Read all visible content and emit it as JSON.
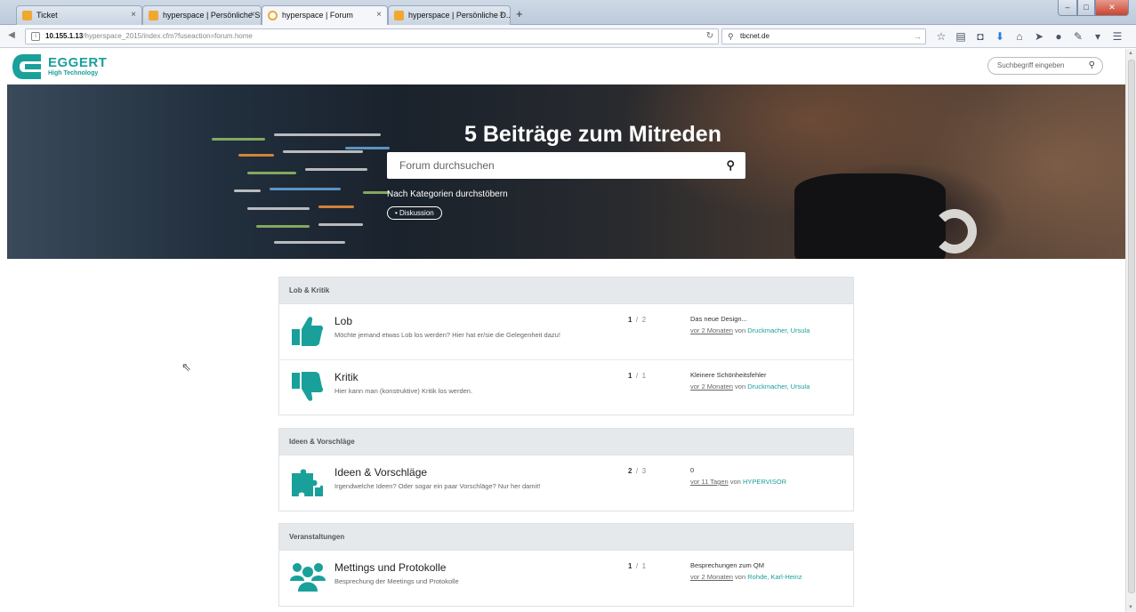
{
  "browser": {
    "tabs": [
      {
        "label": "Ticket",
        "close": "×"
      },
      {
        "label": "hyperspace | Persönliche St...",
        "close": "×"
      },
      {
        "label": "hyperspace | Forum",
        "close": "×"
      },
      {
        "label": "hyperspace | Persönliche D...",
        "close": "×"
      }
    ],
    "new_tab": "+",
    "url_host": "10.155.1.13",
    "url_path": "/hyperspace_2015/index.cfm?fuseaction=forum.home",
    "search_value": "tbcnet.de"
  },
  "site": {
    "logo_brand": "EGGERT",
    "logo_sub": "High Technology",
    "search_placeholder": "Suchbegriff eingeben"
  },
  "hero": {
    "title": "5 Beiträge zum Mitreden",
    "search_placeholder": "Forum durchsuchen",
    "categories_label": "Nach Kategorien durchstöbern",
    "category_pill": "Diskussion"
  },
  "sections": [
    {
      "title": "Lob & Kritik",
      "forums": [
        {
          "icon": "thumbs-up-icon",
          "title": "Lob",
          "description": "Möchte jemand etwas Lob los werden? Hier hat er/sie die Gelegenheit dazu!",
          "topics": "1",
          "sep": "/",
          "posts": "2",
          "last_title": "Das neue Design...",
          "last_when": "vor 2 Monaten",
          "last_by": "von",
          "last_author": "Druckmacher, Ursula"
        },
        {
          "icon": "thumbs-down-icon",
          "title": "Kritik",
          "description": "Hier kann man (konstruktive) Kritik los werden.",
          "topics": "1",
          "sep": "/",
          "posts": "1",
          "last_title": "Kleinere Schönheitsfehler",
          "last_when": "vor 2 Monaten",
          "last_by": "von",
          "last_author": "Druckmacher, Ursula"
        }
      ]
    },
    {
      "title": "Ideen & Vorschläge",
      "forums": [
        {
          "icon": "puzzle-icon",
          "title": "Ideen & Vorschläge",
          "description": "Irgendwelche Ideen? Oder sogar ein paar Vorschläge? Nur her damit!",
          "topics": "2",
          "sep": "/",
          "posts": "3",
          "last_title": "0",
          "last_when": "vor 11 Tagen",
          "last_by": "von",
          "last_author": "HYPERVISOR"
        }
      ]
    },
    {
      "title": "Veranstaltungen",
      "forums": [
        {
          "icon": "group-icon",
          "title": "Mettings und Protokolle",
          "description": "Besprechung der Meetings und Protokolle",
          "topics": "1",
          "sep": "/",
          "posts": "1",
          "last_title": "Besprechungen zum QM",
          "last_when": "vor 2 Monaten",
          "last_by": "von",
          "last_author": "Rohde, Karl-Heinz"
        }
      ]
    }
  ],
  "colors": {
    "accent": "#1aa09a",
    "section_header": "#e6e9ec"
  }
}
